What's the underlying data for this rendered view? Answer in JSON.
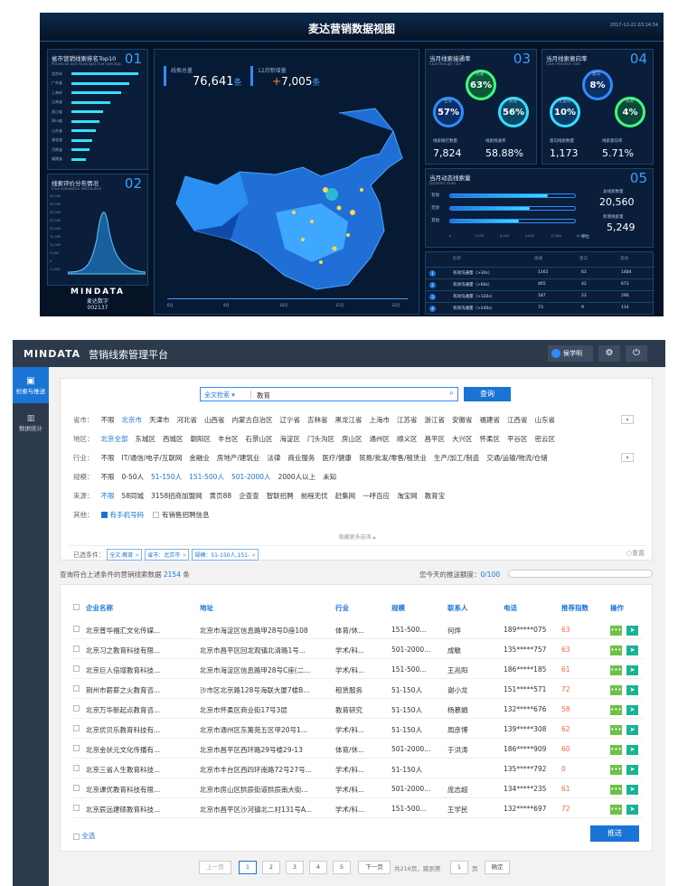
{
  "dashboard": {
    "title": "麦达营销数据视图",
    "datetime": "2017-12-22 03:14:34",
    "ranking": {
      "title": "省市营销线索排名Top10",
      "subtitle": "Provincial and municipal clue rankings",
      "num": "01",
      "rows": [
        {
          "name": "北京市",
          "v": 0.95
        },
        {
          "name": "广东省",
          "v": 0.82
        },
        {
          "name": "上海市",
          "v": 0.7
        },
        {
          "name": "江苏省",
          "v": 0.55
        },
        {
          "name": "浙江省",
          "v": 0.45
        },
        {
          "name": "四川省",
          "v": 0.4
        },
        {
          "name": "山东省",
          "v": 0.35
        },
        {
          "name": "湖北省",
          "v": 0.3
        },
        {
          "name": "河南省",
          "v": 0.25
        },
        {
          "name": "福建省",
          "v": 0.2
        }
      ]
    },
    "evaluation": {
      "title": "线索评价分布情况",
      "subtitle": "Clue evaluation distribution",
      "num": "02",
      "yticks": [
        "40,000",
        "35,000",
        "30,000",
        "25,000",
        "20,000",
        "15,000",
        "10,000",
        "5,000",
        "0",
        "-5,000"
      ]
    },
    "logo": "MINDATA",
    "logo_sub": "麦达数字",
    "code": "002137",
    "total_label": "线索总量",
    "total_value": "76,641",
    "total_unit": "条",
    "new_label": "12月新增量",
    "new_value": "7,005",
    "new_unit": "条",
    "timeline": [
      "6月",
      "9月",
      "10月",
      "11月",
      "12月"
    ],
    "pass_rate": {
      "title": "当月线索接通率",
      "subtitle": "Clue through rate",
      "num": "03",
      "main_label": "接通",
      "main_value": "63%",
      "left_label": "空号",
      "left_value": "57%",
      "right_label": "其他",
      "right_value": "56%",
      "s1_label": "线索拨打数量",
      "s1_value": "7,824",
      "s2_label": "线索接通率",
      "s2_value": "58.88%"
    },
    "retention": {
      "title": "当月线索意向率",
      "subtitle": "Clue retention rate",
      "num": "04",
      "main_label": "意向",
      "main_value": "8%",
      "left_label": "无意向",
      "left_value": "10%",
      "right_label": "其他",
      "right_value": "4%",
      "s1_label": "意向线索数量",
      "s1_value": "1,173",
      "s2_label": "线索意向率",
      "s2_value": "5.71%"
    },
    "dynamic": {
      "title": "当月动态线索量",
      "subtitle": "Dynamic clues",
      "num": "05",
      "rows": [
        {
          "name": "有效",
          "v": 0.78
        },
        {
          "name": "无效",
          "v": 0.64
        },
        {
          "name": "其他",
          "v": 0.55
        }
      ],
      "xticks": [
        "0",
        "3,200",
        "6,400",
        "9,600",
        "12,800",
        "16,000"
      ],
      "xunit": "单位",
      "n1_label": "总线索数量",
      "n1_value": "20,560",
      "n2_label": "新增线索量",
      "n2_value": "5,249"
    },
    "table": {
      "headers": [
        "科目",
        "接通",
        "意向",
        "其他"
      ],
      "rows": [
        [
          "1",
          "有效沟通量（>30s）",
          "1161",
          "63",
          "1484"
        ],
        [
          "2",
          "有效沟通量（>60s）",
          "465",
          "42",
          "673"
        ],
        [
          "3",
          "有效沟通量（>120s）",
          "187",
          "23",
          "290"
        ],
        [
          "4",
          "有效沟通量（>240s）",
          "73",
          "9",
          "114"
        ]
      ]
    }
  },
  "platform": {
    "logo": "MINDATA",
    "title": "营销线索管理平台",
    "user": "侯学明",
    "nav": [
      {
        "label": "检索与推送"
      },
      {
        "label": "数据统计"
      }
    ],
    "search": {
      "type": "全文检索",
      "value": "教育",
      "button": "查询"
    },
    "filters": [
      {
        "label": "省市：",
        "opts": [
          "不限",
          "北京市",
          "天津市",
          "河北省",
          "山西省",
          "内蒙古自治区",
          "辽宁省",
          "吉林省",
          "黑龙江省",
          "上海市",
          "江苏省",
          "浙江省",
          "安徽省",
          "福建省",
          "江西省",
          "山东省"
        ],
        "sel": 1
      },
      {
        "label": "地区：",
        "opts": [
          "北京全部",
          "东城区",
          "西城区",
          "朝阳区",
          "丰台区",
          "石景山区",
          "海淀区",
          "门头沟区",
          "房山区",
          "通州区",
          "顺义区",
          "昌平区",
          "大兴区",
          "怀柔区",
          "平谷区",
          "密云区"
        ],
        "sel": 0
      },
      {
        "label": "行业：",
        "opts": [
          "不限",
          "IT/通信/电子/互联网",
          "金融业",
          "房地产/建筑业",
          "法律",
          "商业服务",
          "医疗/健康",
          "贸易/批发/零售/租赁业",
          "生产/加工/制造",
          "交通/运输/物流/仓储"
        ],
        "sel": -1
      },
      {
        "label": "规模：",
        "opts": [
          "不限",
          "0-50人",
          "51-150人",
          "151-500人",
          "501-2000人",
          "2000人以上",
          "未知"
        ],
        "sel": -1,
        "multi": [
          2,
          3,
          4
        ]
      },
      {
        "label": "来源：",
        "opts": [
          "不限",
          "58同城",
          "3158招商加盟网",
          "黄页88",
          "企查查",
          "智联招聘",
          "前程无忧",
          "赶集网",
          "一呼百应",
          "淘宝网",
          "教育宝"
        ],
        "sel": 0
      },
      {
        "label": "其他：",
        "opts": [
          "有手机号码",
          "有销售招聘信息"
        ],
        "sel": -1
      }
    ],
    "more": "隐藏更多选项",
    "conditions_label": "已选条件：",
    "conditions": [
      "全文:教育",
      "省市：北京市",
      "规模：51-150人,151-"
    ],
    "reset": "重置",
    "result_prefix": "查询符合上述条件的营销线索数据",
    "result_count": "2154",
    "result_suffix": "条",
    "quota_label": "您今天的推送额度：",
    "quota_value": "0/100",
    "table_headers": [
      "企业名称",
      "地址",
      "行业",
      "规模",
      "联系人",
      "电话",
      "推荐指数",
      "操作"
    ],
    "rows": [
      [
        "北京普华福汇文化传媒...",
        "北京市海淀区信息路甲28号D座108",
        "体育/休...",
        "151-500...",
        "何烨",
        "189*****075",
        "63"
      ],
      [
        "北京习之教育科技有限...",
        "北京市昌平区回龙观镇北清路1号...",
        "学术/科...",
        "501-2000...",
        "成敏",
        "135*****757",
        "63"
      ],
      [
        "北京巨人倍增教育科技...",
        "北京市海淀区信息路甲28号C座(二...",
        "学术/科...",
        "151-500...",
        "王兆阳",
        "186*****185",
        "61"
      ],
      [
        "荆州市薪薪之火教育咨...",
        "沙市区北京路128号海联大厦7楼B...",
        "租赁服务",
        "51-150人",
        "谢小龙",
        "151*****571",
        "72"
      ],
      [
        "北京万华新起点教育咨...",
        "北京市怀柔区商业街17号3层",
        "教育研究",
        "51-150人",
        "杨慕娟",
        "132*****676",
        "58"
      ],
      [
        "北京优贝乐教育科技有...",
        "北京市通州区东篱苑五区甲20号1...",
        "学术/科...",
        "51-150人",
        "周彦博",
        "139*****308",
        "62"
      ],
      [
        "北京金状元文化传播有...",
        "北京市昌平区西环路29号楼29-13",
        "体育/休...",
        "501-2000...",
        "于洪涛",
        "186*****909",
        "60"
      ],
      [
        "北京三省人生教育科技...",
        "北京市丰台区西四环南路72号27号...",
        "学术/科...",
        "51-150人",
        "",
        "135*****792",
        "0"
      ],
      [
        "北京课优教育科技有限...",
        "北京市房山区拱辰街道拱辰南大街...",
        "学术/科...",
        "501-2000...",
        "庞志超",
        "134*****235",
        "61"
      ],
      [
        "北京辰远建硕教育科技...",
        "北京市昌平区沙河镇北二村131号A...",
        "学术/科...",
        "151-500...",
        "王学民",
        "132*****697",
        "72"
      ]
    ],
    "select_all": "全选",
    "push": "推送",
    "pager": {
      "prev": "上一页",
      "pages": [
        "1",
        "2",
        "3",
        "4",
        "5"
      ],
      "next": "下一页",
      "total": "共216页，跳到第",
      "jump_value": "1",
      "page_unit": "页",
      "confirm": "确定"
    }
  }
}
